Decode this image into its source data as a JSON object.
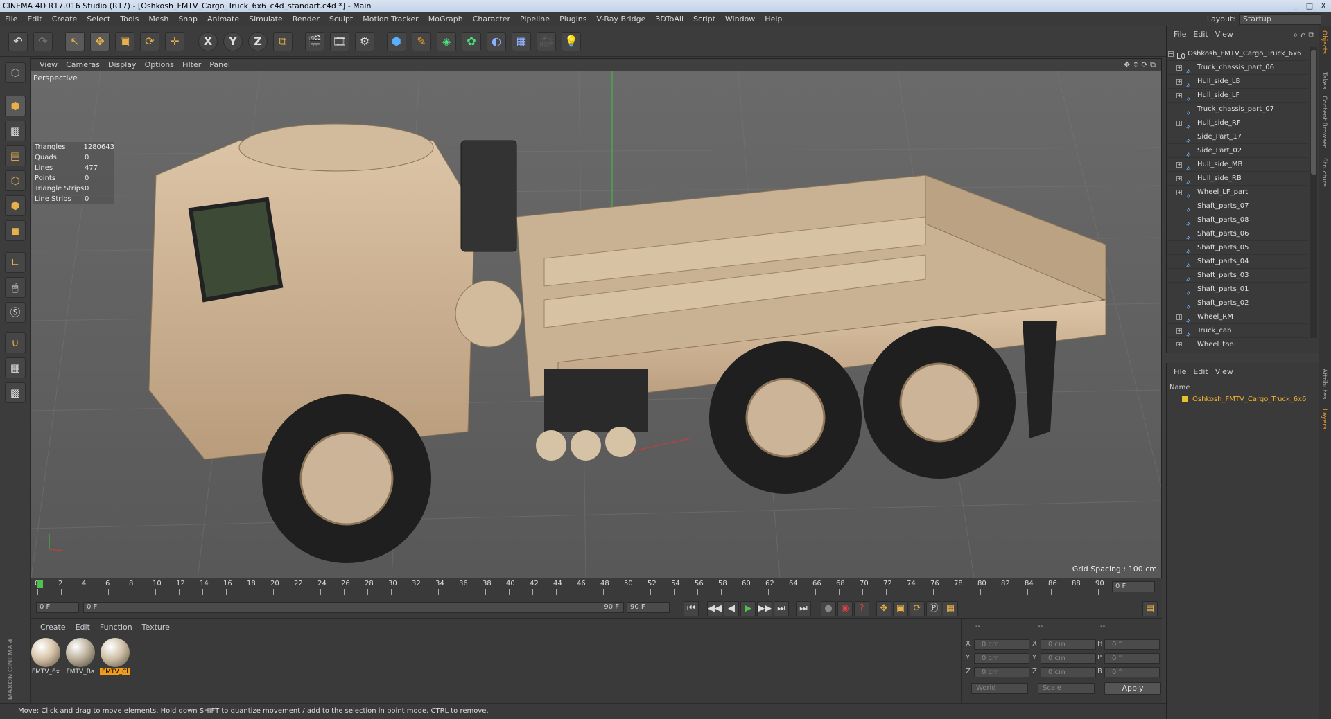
{
  "window": {
    "title": "CINEMA 4D R17.016 Studio (R17) - [Oshkosh_FMTV_Cargo_Truck_6x6_c4d_standart.c4d *] - Main",
    "min": "_",
    "max": "□",
    "close": "X"
  },
  "menu": [
    "File",
    "Edit",
    "Create",
    "Select",
    "Tools",
    "Mesh",
    "Snap",
    "Animate",
    "Simulate",
    "Render",
    "Sculpt",
    "Motion Tracker",
    "MoGraph",
    "Character",
    "Pipeline",
    "Plugins",
    "V-Ray Bridge",
    "3DToAll",
    "Script",
    "Window",
    "Help"
  ],
  "layout": {
    "label": "Layout:",
    "value": "Startup"
  },
  "toolbar": {
    "undo": "↶",
    "redo": "↷",
    "select": "↖",
    "move": "✥",
    "scale": "▣",
    "rotate": "⟳",
    "transform": "✛",
    "x": "X",
    "y": "Y",
    "z": "Z",
    "coord": "⧉",
    "render_view": "🎬",
    "render_pv": "🎞",
    "render_settings": "⚙",
    "cube": "⬢",
    "pen": "✎",
    "subdiv": "◈",
    "cloner": "✿",
    "deformer": "◐",
    "floor": "▦",
    "camera": "🎥",
    "light": "💡"
  },
  "viewport": {
    "menu": [
      "View",
      "Cameras",
      "Display",
      "Options",
      "Filter",
      "Panel"
    ],
    "camera": "Perspective",
    "grid_spacing": "Grid Spacing : 100 cm",
    "nav": "✥ ↕ ⟳ ⧉"
  },
  "stats": [
    {
      "k": "Triangles",
      "v": "1280643"
    },
    {
      "k": "Quads",
      "v": "0"
    },
    {
      "k": "Lines",
      "v": "477"
    },
    {
      "k": "Points",
      "v": "0"
    },
    {
      "k": "Triangle Strips",
      "v": "0"
    },
    {
      "k": "Line Strips",
      "v": "0"
    }
  ],
  "timeline": {
    "ticks": [
      "0",
      "2",
      "4",
      "6",
      "8",
      "10",
      "12",
      "14",
      "16",
      "18",
      "20",
      "22",
      "24",
      "26",
      "28",
      "30",
      "32",
      "34",
      "36",
      "38",
      "40",
      "42",
      "44",
      "46",
      "48",
      "50",
      "52",
      "54",
      "56",
      "58",
      "60",
      "62",
      "64",
      "66",
      "68",
      "70",
      "72",
      "74",
      "76",
      "78",
      "80",
      "82",
      "84",
      "86",
      "88",
      "90"
    ],
    "current": "0 F"
  },
  "transport": {
    "start": "0 F",
    "min": "0 F",
    "max": "90 F",
    "end": "90 F",
    "buttons": [
      "⏮",
      "◀◀",
      "◀",
      "▶",
      "▶▶",
      "⏭",
      "⏭"
    ]
  },
  "materials": {
    "menu": [
      "Create",
      "Edit",
      "Function",
      "Texture"
    ],
    "items": [
      {
        "label": "FMTV_6x",
        "color": "#d6c3a8",
        "selected": false
      },
      {
        "label": "FMTV_Ba",
        "color": "#bcb19c",
        "selected": false
      },
      {
        "label": "FMTV_Cl",
        "color": "#cfc0a6",
        "selected": true
      }
    ]
  },
  "coords": {
    "header": [
      "--",
      "--",
      "--"
    ],
    "rows": [
      {
        "a": "X",
        "av": "0 cm",
        "b": "X",
        "bv": "0 cm",
        "c": "H",
        "cv": "0 °"
      },
      {
        "a": "Y",
        "av": "0 cm",
        "b": "Y",
        "bv": "0 cm",
        "c": "P",
        "cv": "0 °"
      },
      {
        "a": "Z",
        "av": "0 cm",
        "b": "Z",
        "bv": "0 cm",
        "c": "B",
        "cv": "0 °"
      }
    ],
    "world": "World",
    "scale": "Scale",
    "apply": "Apply"
  },
  "brand": "MAXON CINEMA 4D",
  "status": "Move: Click and drag to move elements. Hold down SHIFT to quantize movement / add to the selection in point mode, CTRL to remove.",
  "objects": {
    "menu": [
      "File",
      "Edit",
      "View"
    ],
    "root": "Oshkosh_FMTV_Cargo_Truck_6x6",
    "items": [
      "Truck_chassis_part_06",
      "Hull_side_LB",
      "Hull_side_LF",
      "Truck_chassis_part_07",
      "Hull_side_RF",
      "Side_Part_17",
      "Side_Part_02",
      "Hull_side_MB",
      "Hull_side_RB",
      "Wheel_LF_part",
      "Shaft_parts_07",
      "Shaft_parts_08",
      "Shaft_parts_06",
      "Shaft_parts_05",
      "Shaft_parts_04",
      "Shaft_parts_03",
      "Shaft_parts_01",
      "Shaft_parts_02",
      "Wheel_RM",
      "Truck_cab",
      "Wheel_top"
    ]
  },
  "attributes": {
    "menu": [
      "File",
      "Edit",
      "View"
    ],
    "name_header": "Name",
    "layer": "Oshkosh_FMTV_Cargo_Truck_6x6"
  },
  "sidetabs": [
    "Objects",
    "Takes",
    "Content Browser",
    "Structure",
    "Attributes",
    "Layers"
  ]
}
